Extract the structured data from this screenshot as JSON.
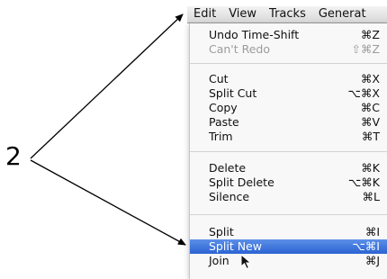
{
  "callout": {
    "label": "2"
  },
  "menubar": {
    "menus": [
      "Edit",
      "View",
      "Tracks",
      "Generat"
    ],
    "active_index": 0
  },
  "edit_menu": {
    "items": [
      {
        "label": "Undo Time-Shift",
        "shortcut": "⌘Z",
        "enabled": true
      },
      {
        "label": "Can't Redo",
        "shortcut": "⇧⌘Z",
        "enabled": false
      },
      {
        "label": "Cut",
        "shortcut": "⌘X",
        "enabled": true
      },
      {
        "label": "Split Cut",
        "shortcut": "⌥⌘X",
        "enabled": true
      },
      {
        "label": "Copy",
        "shortcut": "⌘C",
        "enabled": true
      },
      {
        "label": "Paste",
        "shortcut": "⌘V",
        "enabled": true
      },
      {
        "label": "Trim",
        "shortcut": "⌘T",
        "enabled": true
      },
      {
        "label": "Delete",
        "shortcut": "⌘K",
        "enabled": true
      },
      {
        "label": "Split Delete",
        "shortcut": "⌥⌘K",
        "enabled": true
      },
      {
        "label": "Silence",
        "shortcut": "⌘L",
        "enabled": true
      },
      {
        "label": "Split",
        "shortcut": "⌘I",
        "enabled": true
      },
      {
        "label": "Split New",
        "shortcut": "⌥⌘I",
        "enabled": true,
        "selected": true
      },
      {
        "label": "Join",
        "shortcut": "⌘J",
        "enabled": true
      }
    ]
  },
  "colors": {
    "selection": "#2b63d2",
    "disabled_text": "#9c9c9c",
    "arrow": "#000000"
  }
}
